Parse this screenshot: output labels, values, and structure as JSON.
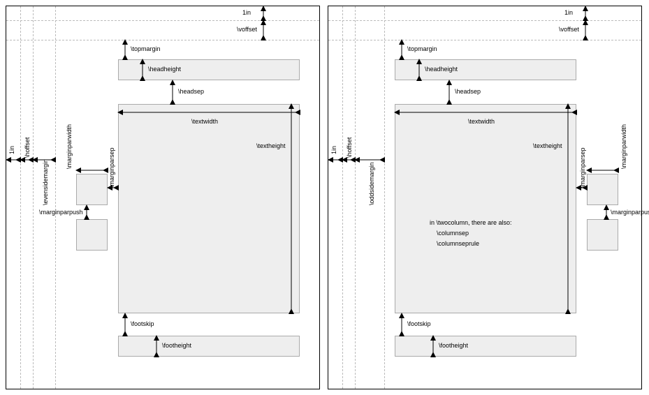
{
  "labels": {
    "one_in": "1in",
    "voffset": "\\voffset",
    "topmargin": "\\topmargin",
    "headheight": "\\headheight",
    "headsep": "\\headsep",
    "textwidth": "\\textwidth",
    "textheight": "\\textheight",
    "hoffset": "\\hoffset",
    "evensidemargin": "\\evensidemargin",
    "oddsidemargin": "\\oddsidemargin",
    "marginparwidth": "\\marginparwidth",
    "marginparsep": "\\marginparsep",
    "marginparpush": "\\marginparpush",
    "footskip": "\\footskip",
    "footheight": "\\footheight"
  },
  "twocolumn": {
    "intro": "in \\twocolumn, there are also:",
    "a": "\\columnsep",
    "b": "\\columnseprule"
  },
  "chart_data": [
    {
      "type": "diagram",
      "side": "even",
      "parameters": [
        "1in",
        "\\voffset",
        "\\topmargin",
        "\\headheight",
        "\\headsep",
        "\\textwidth",
        "\\textheight",
        "\\hoffset",
        "\\evensidemargin",
        "\\marginparwidth",
        "\\marginparsep",
        "\\marginparpush",
        "\\footskip",
        "\\footheight"
      ]
    },
    {
      "type": "diagram",
      "side": "odd",
      "parameters": [
        "1in",
        "\\voffset",
        "\\topmargin",
        "\\headheight",
        "\\headsep",
        "\\textwidth",
        "\\textheight",
        "\\hoffset",
        "\\oddsidemargin",
        "\\marginparwidth",
        "\\marginparsep",
        "\\marginparpush",
        "\\footskip",
        "\\footheight",
        "\\columnsep",
        "\\columnseprule"
      ]
    }
  ]
}
